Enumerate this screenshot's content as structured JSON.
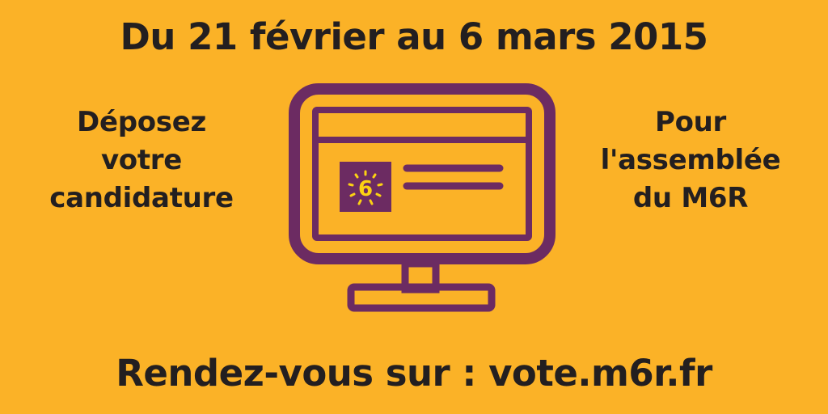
{
  "headline": "Du 21 février au 6 mars 2015",
  "left_text": [
    "Déposez",
    "votre",
    "candidature"
  ],
  "right_text": [
    "Pour",
    "l'assemblée",
    "du M6R"
  ],
  "footer": "Rendez-vous sur : vote.m6r.fr",
  "logo_text": "6",
  "colors": {
    "background": "#fbb227",
    "text": "#231f20",
    "monitor": "#6c2b62",
    "logo_accent": "#fcd212"
  },
  "icons": {
    "monitor": "computer-monitor-icon",
    "logo": "m6r-logo-icon"
  }
}
